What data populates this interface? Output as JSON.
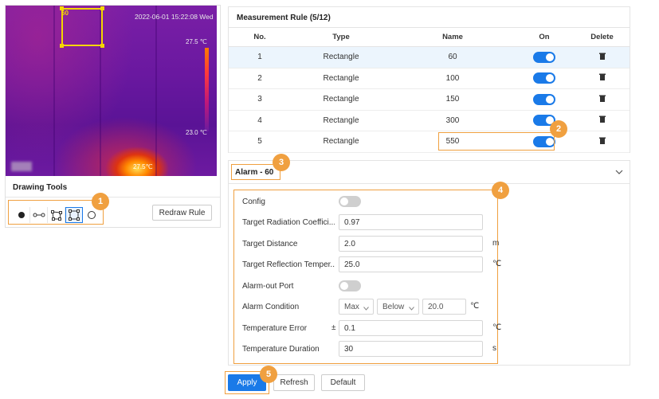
{
  "thermal_view": {
    "timestamp": "2022-06-01 15:22:08 Wed",
    "rect_label": "60",
    "scale_max": "27.5 ℃",
    "scale_min": "23.0 ℃",
    "spot_temp": "27.5℃"
  },
  "drawing_tools": {
    "title": "Drawing Tools",
    "tools": [
      {
        "icon": "point-tool-icon"
      },
      {
        "icon": "line-tool-icon"
      },
      {
        "icon": "polygon-tool-icon"
      },
      {
        "icon": "rectangle-tool-icon",
        "active": true
      },
      {
        "icon": "circle-tool-icon"
      }
    ],
    "redraw_label": "Redraw Rule"
  },
  "measurement_rule": {
    "title": "Measurement Rule (5/12)",
    "columns": [
      "No.",
      "Type",
      "Name",
      "On",
      "Delete"
    ],
    "rows": [
      {
        "no": "1",
        "type": "Rectangle",
        "name": "60",
        "on": true
      },
      {
        "no": "2",
        "type": "Rectangle",
        "name": "100",
        "on": true
      },
      {
        "no": "3",
        "type": "Rectangle",
        "name": "150",
        "on": true
      },
      {
        "no": "4",
        "type": "Rectangle",
        "name": "300",
        "on": true
      },
      {
        "no": "5",
        "type": "Rectangle",
        "name": "550",
        "on": true
      }
    ]
  },
  "alarm": {
    "title": "Alarm - 60",
    "config_label": "Config",
    "config_on": false,
    "target_radiation_label": "Target Radiation Coeffici...",
    "target_radiation_value": "0.97",
    "target_distance_label": "Target Distance",
    "target_distance_value": "2.0",
    "target_distance_unit": "m",
    "target_reflection_label": "Target Reflection Temper...",
    "target_reflection_value": "25.0",
    "target_reflection_unit": "℃",
    "alarm_out_label": "Alarm-out Port",
    "alarm_out_on": false,
    "alarm_condition_label": "Alarm Condition",
    "alarm_condition_mode": "Max",
    "alarm_condition_compare": "Below",
    "alarm_condition_value": "20.0",
    "alarm_condition_unit": "℃",
    "temp_error_label": "Temperature Error",
    "temp_error_sign": "±",
    "temp_error_value": "0.1",
    "temp_error_unit": "℃",
    "temp_duration_label": "Temperature Duration",
    "temp_duration_value": "30",
    "temp_duration_unit": "s"
  },
  "buttons": {
    "apply": "Apply",
    "refresh": "Refresh",
    "default": "Default"
  },
  "callouts": [
    "1",
    "2",
    "3",
    "4",
    "5"
  ],
  "colors": {
    "accent": "#1a7ae8",
    "callout": "#f0a040",
    "selected_row": "#ecf5fd"
  }
}
